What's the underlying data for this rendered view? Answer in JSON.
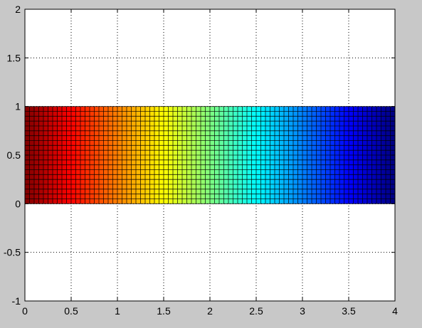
{
  "chart_data": {
    "type": "heatmap",
    "title": "",
    "xlabel": "",
    "ylabel": "",
    "xlim": [
      0,
      4
    ],
    "ylim": [
      -1,
      2
    ],
    "grid": true,
    "grid_style": "dotted",
    "colormap": "jet",
    "colormap_direction": "reversed (dark red at x=0 to dark blue at x=4)",
    "x_ticks": [
      0,
      0.5,
      1,
      1.5,
      2,
      2.5,
      3,
      3.5,
      4
    ],
    "y_ticks": [
      -1,
      -0.5,
      0,
      0.5,
      1,
      1.5,
      2
    ],
    "x_tick_labels": [
      "0",
      "0.5",
      "1",
      "1.5",
      "2",
      "2.5",
      "3",
      "3.5",
      "4"
    ],
    "y_tick_labels": [
      "-1",
      "-0.5",
      "0",
      "0.5",
      "1",
      "1.5",
      "2"
    ],
    "mesh": {
      "x_range": [
        0,
        4
      ],
      "y_range": [
        0,
        1
      ],
      "nx": 80,
      "ny": 20,
      "edge_color": "#000000",
      "value_trend": "color varies linearly with x only"
    }
  },
  "colors": {
    "figure_background": "#c8c8c8",
    "axes_background": "#ffffff",
    "grid": "#000000"
  }
}
